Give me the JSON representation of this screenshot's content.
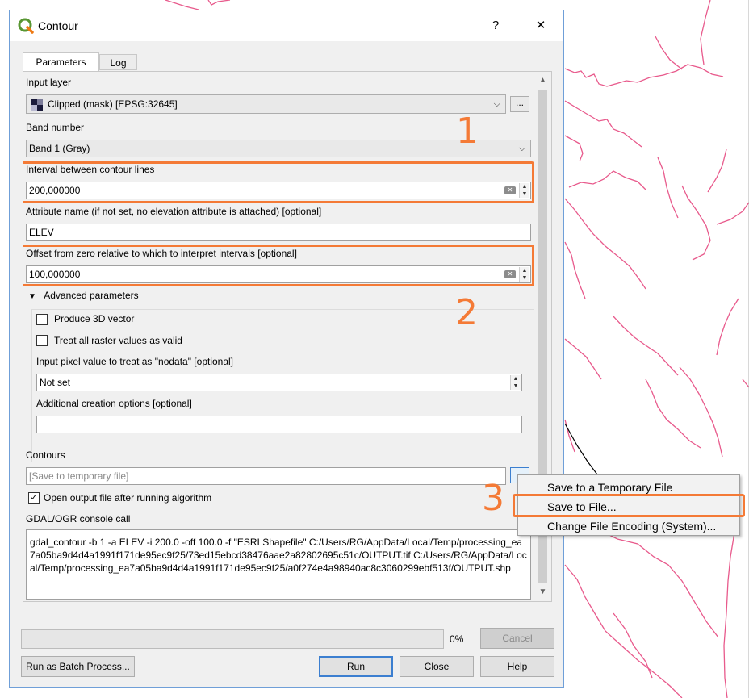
{
  "window": {
    "title": "Contour",
    "help_label": "?",
    "close_label": "✕"
  },
  "tabs": [
    {
      "label": "Parameters"
    },
    {
      "label": "Log"
    }
  ],
  "params": {
    "input_layer_label": "Input layer",
    "input_layer_value": "Clipped (mask) [EPSG:32645]",
    "browse_label": "...",
    "band_label": "Band number",
    "band_value": "Band 1 (Gray)",
    "interval_label": "Interval between contour lines",
    "interval_value": "200,000000",
    "attribute_label": "Attribute name (if not set, no elevation attribute is attached) [optional]",
    "attribute_value": "ELEV",
    "offset_label": "Offset from zero relative to which to interpret intervals [optional]",
    "offset_value": "100,000000"
  },
  "advanced": {
    "header": "Advanced parameters",
    "produce_3d_label": "Produce 3D vector",
    "produce_3d_checked": false,
    "raster_valid_label": "Treat all raster values as valid",
    "raster_valid_checked": false,
    "nodata_label": "Input pixel value to treat as \"nodata\" [optional]",
    "nodata_value": "Not set",
    "creation_label": "Additional creation options [optional]",
    "creation_value": ""
  },
  "output": {
    "contours_label": "Contours",
    "contours_placeholder": "[Save to temporary file]",
    "browse_label": "...",
    "open_output_label": "Open output file after running algorithm",
    "open_output_checked": true,
    "console_label": "GDAL/OGR console call",
    "console_text": "gdal_contour -b 1 -a ELEV -i 200.0 -off 100.0 -f \"ESRI Shapefile\" C:/Users/RG/AppData/Local/Temp/processing_ea7a05ba9d4d4a1991f171de95ec9f25/73ed15ebcd38476aae2a82802695c51c/OUTPUT.tif C:/Users/RG/AppData/Local/Temp/processing_ea7a05ba9d4d4a1991f171de95ec9f25/a0f274e4a98940ac8c3060299ebf513f/OUTPUT.shp"
  },
  "progress": {
    "percent": 0,
    "percent_label": "0%"
  },
  "buttons": {
    "cancel": "Cancel",
    "batch": "Run as Batch Process...",
    "run": "Run",
    "close": "Close",
    "help": "Help"
  },
  "menu": {
    "items": [
      "Save to a Temporary File",
      "Save to File...",
      "Change File Encoding (System)..."
    ]
  },
  "annotations": {
    "one": "1",
    "two": "2",
    "three": "3"
  },
  "colors": {
    "highlight": "#f47a36",
    "map_lines": "#e85a8c",
    "dialog_border": "#6f9fd8"
  }
}
